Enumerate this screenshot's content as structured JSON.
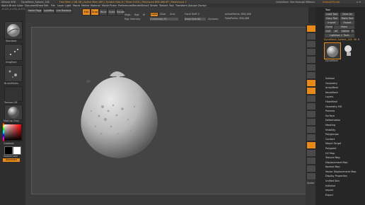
{
  "titlebar": {
    "app": "ZBrush 4R8",
    "doc": "DynaMesh_Sphere_128",
    "info": "Free Mem 2.9B GB | Active Mem 667 | Scratch Disk 8 | Timer 0.002 | PolyCount 806.466 KP | MeshCount 1",
    "quicksave": "QuickSave",
    "seethrough": "See-through 0",
    "menus_label": "Menus",
    "defaultscript": "DefaultZScript"
  },
  "menubar": [
    "Alpha",
    "Brush",
    "Color",
    "Document",
    "Draw",
    "Edit",
    "File",
    "Layer",
    "Light",
    "Macro",
    "Marker",
    "Material",
    "Movie",
    "Picker",
    "Preferences",
    "Render",
    "Stencil",
    "Stroke",
    "Texture",
    "Tool",
    "Transform",
    "Zplugin",
    "Zscript"
  ],
  "coords": "-0.021,0.376,-0.971",
  "left": {
    "home": "Home Page",
    "lightbox": "LightBox",
    "liveboolean": "Live Boolean",
    "tiles": [
      "Standard",
      "DragRect",
      "BrushMarks",
      "Texture Off",
      "MatCap Gray"
    ],
    "gradient": "Gradient",
    "switchcolor": "SwitchColor",
    "alternate": "Alternate"
  },
  "topbar": {
    "edit": "Edit",
    "draw": "Draw",
    "move": "Move",
    "scale": "Scale",
    "rotate": "Rotate",
    "mrgb": "Mrgb",
    "rgb": "Rgb",
    "m": "M",
    "zadd": "Zadd",
    "zsub": "Zsub",
    "zcut": "Zcut",
    "rgb_intensity": "Rgb Intensity",
    "z_intensity": "Z Intensity 25",
    "focal_shift": "Focal Shift 0",
    "draw_size": "Draw Size 64",
    "dynamic": "Dynamic",
    "active_points": "ActivePoints: 806,466",
    "total_points": "TotalPoints: 806,466"
  },
  "shelf": [
    "Bpr",
    "SPix 3",
    "Scroll",
    "Zoom",
    "Actual",
    "AAHalf",
    "Persp",
    "Floor",
    "Local",
    "Gxyz",
    "Frame",
    "Move",
    "Scale",
    "Rotate",
    "Line Fill",
    "PolyF",
    "Transp",
    "Ghost",
    "Solo",
    "Xpose"
  ],
  "right": {
    "title": "Tool",
    "buttons": [
      "Load Tool",
      "Save As",
      "Copy Tool",
      "Paste Tool",
      "Import",
      "Export",
      "Clone",
      "Make PolyMesh3D",
      "GoZ",
      "All",
      "Visible",
      "R",
      "Lightbox > Tools"
    ],
    "current_tool": "DynaMesh_Sphere_128. 48",
    "r_label": "R",
    "thumb_label": "DynaMesh",
    "palettes": [
      "Subtool",
      "Geometry",
      "ArrayMesh",
      "NanoMesh",
      "Layers",
      "FiberMesh",
      "Geometry HD",
      "Preview",
      "Surface",
      "Deformation",
      "Masking",
      "Visibility",
      "Polygroups",
      "Contact",
      "Morph Target",
      "Polypaint",
      "UV Map",
      "Texture Map",
      "Displacement Map",
      "Normal Map",
      "Vector Displacement Map",
      "Display Properties",
      "Unified Skin",
      "Initialize",
      "Import",
      "Export"
    ]
  },
  "colors": {
    "accent": "#e78a1a",
    "canvas": "#444444"
  }
}
